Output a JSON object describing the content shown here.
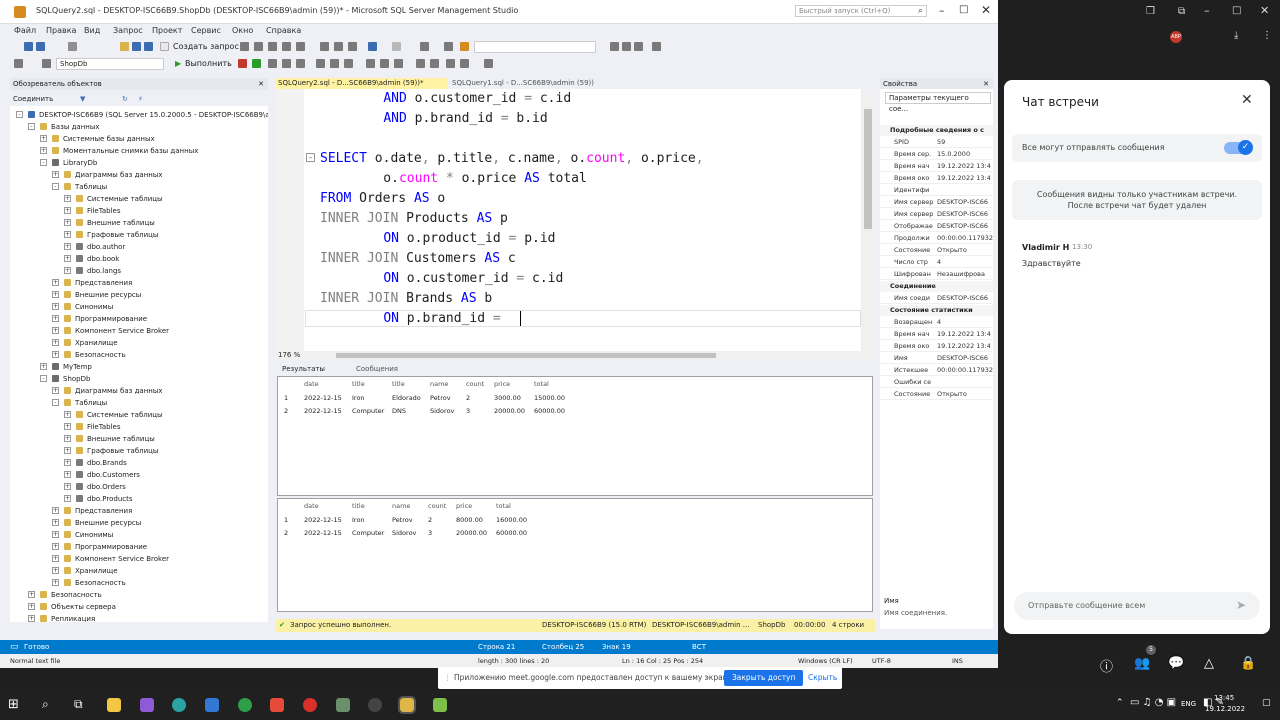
{
  "window": {
    "title": "SQLQuery2.sql - DESKTOP-ISC66B9.ShopDb (DESKTOP-ISC66B9\\admin (59))* - Microsoft SQL Server Management Studio",
    "quick_launch": "Быстрый запуск (Ctrl+Q)"
  },
  "menu": [
    "Файл",
    "Правка",
    "Вид",
    "Запрос",
    "Проект",
    "Сервис",
    "Окно",
    "Справка"
  ],
  "toolbar": {
    "new_query": "Создать запрос",
    "database": "ShopDb",
    "execute": "Выполнить"
  },
  "object_explorer": {
    "title": "Обозреватель объектов",
    "connect": "Соединить",
    "nodes": [
      {
        "label": "DESKTOP-ISC66B9 (SQL Server 15.0.2000.5 - DESKTOP-ISC66B9\\admin)",
        "level": 0,
        "exp": "-",
        "icon": "server"
      },
      {
        "label": "Базы данных",
        "level": 1,
        "exp": "-",
        "icon": "folder"
      },
      {
        "label": "Системные базы данных",
        "level": 2,
        "exp": "+",
        "icon": "folder"
      },
      {
        "label": "Моментальные снимки базы данных",
        "level": 2,
        "exp": "+",
        "icon": "folder"
      },
      {
        "label": "LibraryDb",
        "level": 2,
        "exp": "-",
        "icon": "db"
      },
      {
        "label": "Диаграммы баз данных",
        "level": 3,
        "exp": "+",
        "icon": "folder"
      },
      {
        "label": "Таблицы",
        "level": 3,
        "exp": "-",
        "icon": "folder"
      },
      {
        "label": "Системные таблицы",
        "level": 4,
        "exp": "+",
        "icon": "folder"
      },
      {
        "label": "FileTables",
        "level": 4,
        "exp": "+",
        "icon": "folder"
      },
      {
        "label": "Внешние таблицы",
        "level": 4,
        "exp": "+",
        "icon": "folder"
      },
      {
        "label": "Графовые таблицы",
        "level": 4,
        "exp": "+",
        "icon": "folder"
      },
      {
        "label": "dbo.author",
        "level": 4,
        "exp": "+",
        "icon": "table"
      },
      {
        "label": "dbo.book",
        "level": 4,
        "exp": "+",
        "icon": "table"
      },
      {
        "label": "dbo.langs",
        "level": 4,
        "exp": "+",
        "icon": "table"
      },
      {
        "label": "Представления",
        "level": 3,
        "exp": "+",
        "icon": "folder"
      },
      {
        "label": "Внешние ресурсы",
        "level": 3,
        "exp": "+",
        "icon": "folder"
      },
      {
        "label": "Синонимы",
        "level": 3,
        "exp": "+",
        "icon": "folder"
      },
      {
        "label": "Программирование",
        "level": 3,
        "exp": "+",
        "icon": "folder"
      },
      {
        "label": "Компонент Service Broker",
        "level": 3,
        "exp": "+",
        "icon": "folder"
      },
      {
        "label": "Хранилище",
        "level": 3,
        "exp": "+",
        "icon": "folder"
      },
      {
        "label": "Безопасность",
        "level": 3,
        "exp": "+",
        "icon": "folder"
      },
      {
        "label": "MyTemp",
        "level": 2,
        "exp": "+",
        "icon": "db"
      },
      {
        "label": "ShopDb",
        "level": 2,
        "exp": "-",
        "icon": "db"
      },
      {
        "label": "Диаграммы баз данных",
        "level": 3,
        "exp": "+",
        "icon": "folder"
      },
      {
        "label": "Таблицы",
        "level": 3,
        "exp": "-",
        "icon": "folder"
      },
      {
        "label": "Системные таблицы",
        "level": 4,
        "exp": "+",
        "icon": "folder"
      },
      {
        "label": "FileTables",
        "level": 4,
        "exp": "+",
        "icon": "folder"
      },
      {
        "label": "Внешние таблицы",
        "level": 4,
        "exp": "+",
        "icon": "folder"
      },
      {
        "label": "Графовые таблицы",
        "level": 4,
        "exp": "+",
        "icon": "folder"
      },
      {
        "label": "dbo.Brands",
        "level": 4,
        "exp": "+",
        "icon": "table"
      },
      {
        "label": "dbo.Customers",
        "level": 4,
        "exp": "+",
        "icon": "table"
      },
      {
        "label": "dbo.Orders",
        "level": 4,
        "exp": "+",
        "icon": "table"
      },
      {
        "label": "dbo.Products",
        "level": 4,
        "exp": "+",
        "icon": "table"
      },
      {
        "label": "Представления",
        "level": 3,
        "exp": "+",
        "icon": "folder"
      },
      {
        "label": "Внешние ресурсы",
        "level": 3,
        "exp": "+",
        "icon": "folder"
      },
      {
        "label": "Синонимы",
        "level": 3,
        "exp": "+",
        "icon": "folder"
      },
      {
        "label": "Программирование",
        "level": 3,
        "exp": "+",
        "icon": "folder"
      },
      {
        "label": "Компонент Service Broker",
        "level": 3,
        "exp": "+",
        "icon": "folder"
      },
      {
        "label": "Хранилище",
        "level": 3,
        "exp": "+",
        "icon": "folder"
      },
      {
        "label": "Безопасность",
        "level": 3,
        "exp": "+",
        "icon": "folder"
      },
      {
        "label": "Безопасность",
        "level": 1,
        "exp": "+",
        "icon": "folder"
      },
      {
        "label": "Объекты сервера",
        "level": 1,
        "exp": "+",
        "icon": "folder"
      },
      {
        "label": "Репликация",
        "level": 1,
        "exp": "+",
        "icon": "folder"
      }
    ]
  },
  "tabs": [
    {
      "label": "SQLQuery2.sql - D...SC66B9\\admin (59))*",
      "active": true
    },
    {
      "label": "SQLQuery1.sql - D...SC66B9\\admin (59))",
      "active": false
    }
  ],
  "code": {
    "lines": [
      [
        "    ",
        "kw:AND",
        " o.customer_id ",
        "gr:=",
        " c.id"
      ],
      [
        "    ",
        "kw:AND",
        " p.brand_id ",
        "gr:=",
        " b.id"
      ],
      [
        ""
      ],
      [
        "kw:SELECT",
        " o.date",
        "gr:,",
        " p.title",
        "gr:,",
        " c.name",
        "gr:,",
        " o.",
        "pk:count",
        "gr:,",
        " o.price",
        "gr:,"
      ],
      [
        "    o.",
        "pk:count",
        " ",
        "gr:*",
        " o.price ",
        "kw:AS",
        " total"
      ],
      [
        "kw:FROM",
        " Orders ",
        "kw:AS",
        " o"
      ],
      [
        "gr:INNER JOIN",
        " Products ",
        "kw:AS",
        " p"
      ],
      [
        "    ",
        "kw:ON",
        " o.product_id ",
        "gr:=",
        " p.id"
      ],
      [
        "gr:INNER JOIN",
        " Customers ",
        "kw:AS",
        " c"
      ],
      [
        "    ",
        "kw:ON",
        " o.customer_id ",
        "gr:=",
        " c.id"
      ],
      [
        "gr:INNER JOIN",
        " Brands ",
        "kw:AS",
        " b"
      ],
      [
        "    ",
        "kw:ON",
        " p.brand_id ",
        "gr:=",
        " "
      ]
    ],
    "zoom": "176 %"
  },
  "results": {
    "tab_results": "Результаты",
    "tab_messages": "Сообщения",
    "grid1": {
      "columns": [
        "date",
        "title",
        "title",
        "name",
        "count",
        "price",
        "total"
      ],
      "rows": [
        [
          "1",
          "2022-12-15",
          "Iron",
          "Eldorado",
          "Petrov",
          "2",
          "3000.00",
          "15000.00"
        ],
        [
          "2",
          "2022-12-15",
          "Computer",
          "DNS",
          "Sidorov",
          "3",
          "20000.00",
          "60000.00"
        ]
      ]
    },
    "grid2": {
      "columns": [
        "date",
        "title",
        "name",
        "count",
        "price",
        "total"
      ],
      "rows": [
        [
          "1",
          "2022-12-15",
          "Iron",
          "Petrov",
          "2",
          "8000.00",
          "16000.00"
        ],
        [
          "2",
          "2022-12-15",
          "Computer",
          "Sidorov",
          "3",
          "20000.00",
          "60000.00"
        ]
      ]
    }
  },
  "query_status": {
    "message": "Запрос успешно выполнен.",
    "server": "DESKTOP-ISC66B9 (15.0 RTM)",
    "user": "DESKTOP-ISC66B9\\admin ...",
    "db": "ShopDb",
    "time": "00:00:00",
    "rows": "4 строки"
  },
  "properties": {
    "title": "Свойства",
    "selector": "Параметры текущего сое...",
    "section1": "Подробные сведения о с",
    "rows1": [
      [
        "SPID",
        "59"
      ],
      [
        "Время сер.",
        "15.0.2000"
      ],
      [
        "Время нач",
        "19.12.2022 13:4"
      ],
      [
        "Время око",
        "19.12.2022 13:4"
      ],
      [
        "Идентифи",
        ""
      ],
      [
        "Имя сервер",
        "DESKTOP-ISC66"
      ],
      [
        "Имя сервер",
        "DESKTOP-ISC66"
      ],
      [
        "Отображае",
        "DESKTOP-ISC66"
      ],
      [
        "Продолжи",
        "00:00:00.117932"
      ],
      [
        "Состояние",
        "Открыто"
      ],
      [
        "Число стр",
        "4"
      ],
      [
        "Шифрован",
        "Незашифрова"
      ]
    ],
    "section2": "Соединение",
    "rows2": [
      [
        "Имя соеди",
        "DESKTOP-ISC66"
      ]
    ],
    "section3": "Состояние статистики",
    "rows3": [
      [
        "Возвращен",
        "4"
      ],
      [
        "Время нач",
        "19.12.2022 13:4"
      ],
      [
        "Время око",
        "19.12.2022 13:4"
      ],
      [
        "Имя",
        "DESKTOP-ISC66"
      ],
      [
        "Истекшее",
        "00:00:00.117932"
      ],
      [
        "Ошибки се",
        ""
      ],
      [
        "Состояние",
        "Открыто"
      ]
    ],
    "footer_label": "Имя",
    "footer_desc": "Имя соединения."
  },
  "statusbar": {
    "ready": "Готово",
    "row": "Строка 21",
    "col": "Столбец 25",
    "char": "Знак 19",
    "ins": "ВСТ"
  },
  "notepad": {
    "type": "Normal text file",
    "length": "length : 300   lines : 20",
    "pos": "Ln : 16   Col : 25   Pos : 254",
    "eol": "Windows (CR LF)",
    "enc": "UTF-8",
    "mode": "INS"
  },
  "share_bar": {
    "message": "Приложению meet.google.com предоставлен доступ к вашему экрану.",
    "stop": "Закрыть доступ",
    "hide": "Скрыть"
  },
  "chat": {
    "title": "Чат встречи",
    "toggle_label": "Все могут отправлять сообщения",
    "info": "Сообщения видны только участникам встречи. После встречи чат будет удален",
    "author": "Vladimir H",
    "time": "13:30",
    "message": "Здравствуйте",
    "input_placeholder": "Отправьте сообщение всем",
    "people_badge": "5"
  },
  "taskbar": {
    "lang": "ENG",
    "time": "13:45",
    "date": "19.12.2022"
  }
}
